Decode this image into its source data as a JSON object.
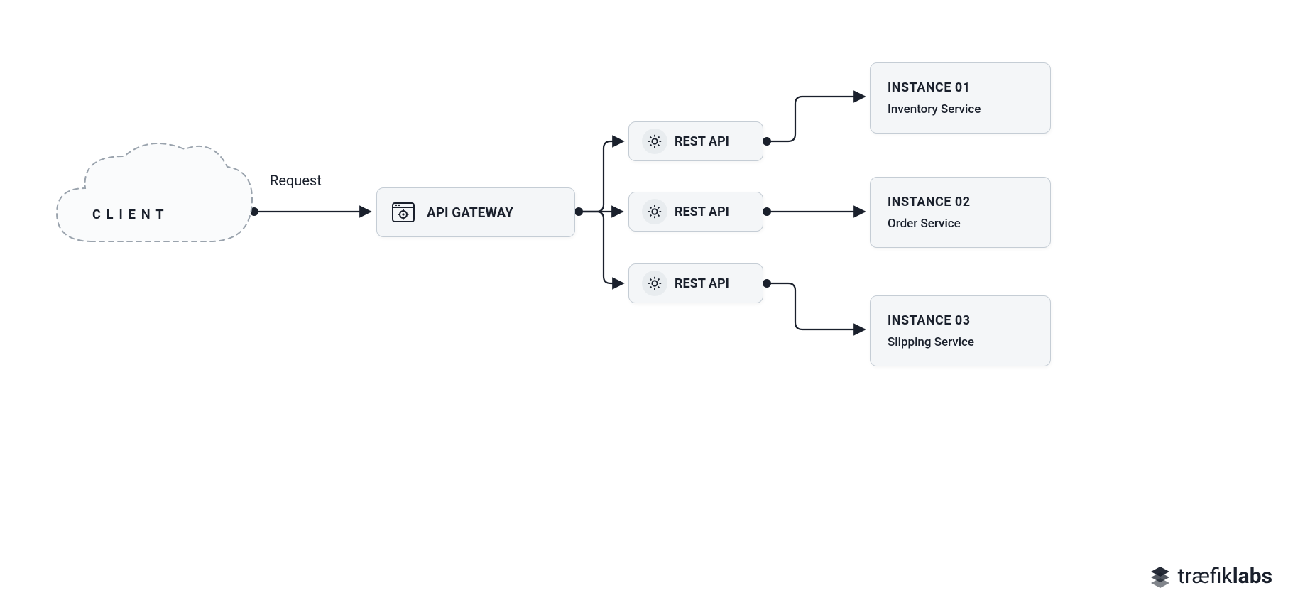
{
  "client": {
    "label": "CLIENT"
  },
  "request_label": "Request",
  "gateway": {
    "label": "API GATEWAY"
  },
  "rest_apis": [
    {
      "label": "REST API"
    },
    {
      "label": "REST API"
    },
    {
      "label": "REST API"
    }
  ],
  "instances": [
    {
      "title": "INSTANCE 01",
      "subtitle": "Inventory Service"
    },
    {
      "title": "INSTANCE 02",
      "subtitle": "Order Service"
    },
    {
      "title": "INSTANCE 03",
      "subtitle": "Slipping Service"
    }
  ],
  "brand": {
    "part1": "træfik",
    "part2": "labs"
  },
  "colors": {
    "box_bg": "#f4f6f8",
    "box_border": "#c5cdd5",
    "text": "#1a202c",
    "line": "#1a202c"
  }
}
